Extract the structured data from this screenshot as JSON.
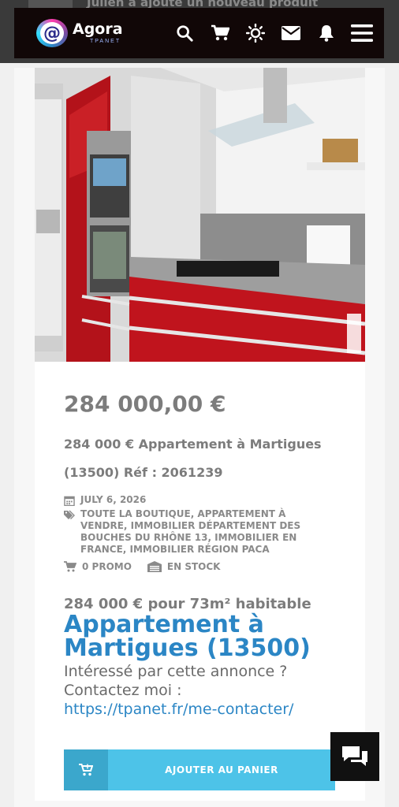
{
  "background": {
    "ghost_text": "Julien a ajouté un nouveau produit"
  },
  "header": {
    "logo_letter": "@",
    "logo_name": "Agora",
    "logo_sub": "TPANET",
    "icons": [
      "search-icon",
      "cart-icon",
      "sun-icon",
      "mail-icon",
      "bell-icon",
      "menu-icon"
    ]
  },
  "product": {
    "price": "284 000,00 €",
    "title": "284 000 € Appartement à Martigues (13500) Réf : 2061239",
    "date": "JULY 6, 2026",
    "categories": "TOUTE LA BOUTIQUE, APPARTEMENT À VENDRE, IMMOBILIER DÉPARTEMENT DES BOUCHES DU RHÔNE 13, IMMOBILIER EN FRANCE, IMMOBILIER RÉGION PACA",
    "promo": "0 PROMO",
    "stock": "EN STOCK"
  },
  "description": {
    "headline": "284 000 € pour 73m² habitable",
    "big_title": "Appartement à Martigues (13500)",
    "body": "Intéressé par cette annonce ? Contactez moi :",
    "link": "https://tpanet.fr/me-contacter/"
  },
  "actions": {
    "add_to_cart": "AJOUTER AU PANIER"
  },
  "colors": {
    "accent_blue": "#2b86c5",
    "button": "#4dc3e8",
    "header_bg": "#110707"
  }
}
